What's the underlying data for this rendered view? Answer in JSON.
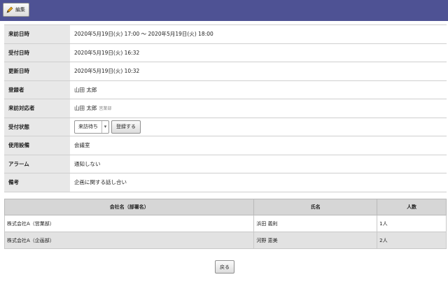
{
  "toolbar": {
    "edit_label": "編集"
  },
  "details": {
    "visit_datetime": {
      "label": "来訪日時",
      "value": "2020年5月19日(火) 17:00 〜 2020年5月19日(火) 18:00"
    },
    "received_datetime": {
      "label": "受付日時",
      "value": "2020年5月19日(火) 16:32"
    },
    "updated_datetime": {
      "label": "更新日時",
      "value": "2020年5月19日(火) 10:32"
    },
    "registrant": {
      "label": "登録者",
      "value": "山田 太郎"
    },
    "visit_handler": {
      "label": "来訪対応者",
      "value": "山田 太郎",
      "dept": "営業部"
    },
    "reception_status": {
      "label": "受付状態",
      "selected": "来訪待ち",
      "register_label": "登録する"
    },
    "equipment": {
      "label": "使用設備",
      "value": "会議室"
    },
    "alarm": {
      "label": "アラーム",
      "value": "通知しない"
    },
    "remarks": {
      "label": "備考",
      "value": "企画に関する話し合い"
    }
  },
  "company_table": {
    "headers": [
      "会社名（部署名）",
      "氏名",
      "人数"
    ],
    "rows": [
      [
        "株式会社A（営業部）",
        "浜田 義則",
        "1人"
      ],
      [
        "株式会社A（企画部）",
        "河野 恵美",
        "2人"
      ]
    ]
  },
  "footer": {
    "back_label": "戻る"
  },
  "colors": {
    "header_bar": "#4e5294",
    "label_bg": "#e8e8e8"
  }
}
